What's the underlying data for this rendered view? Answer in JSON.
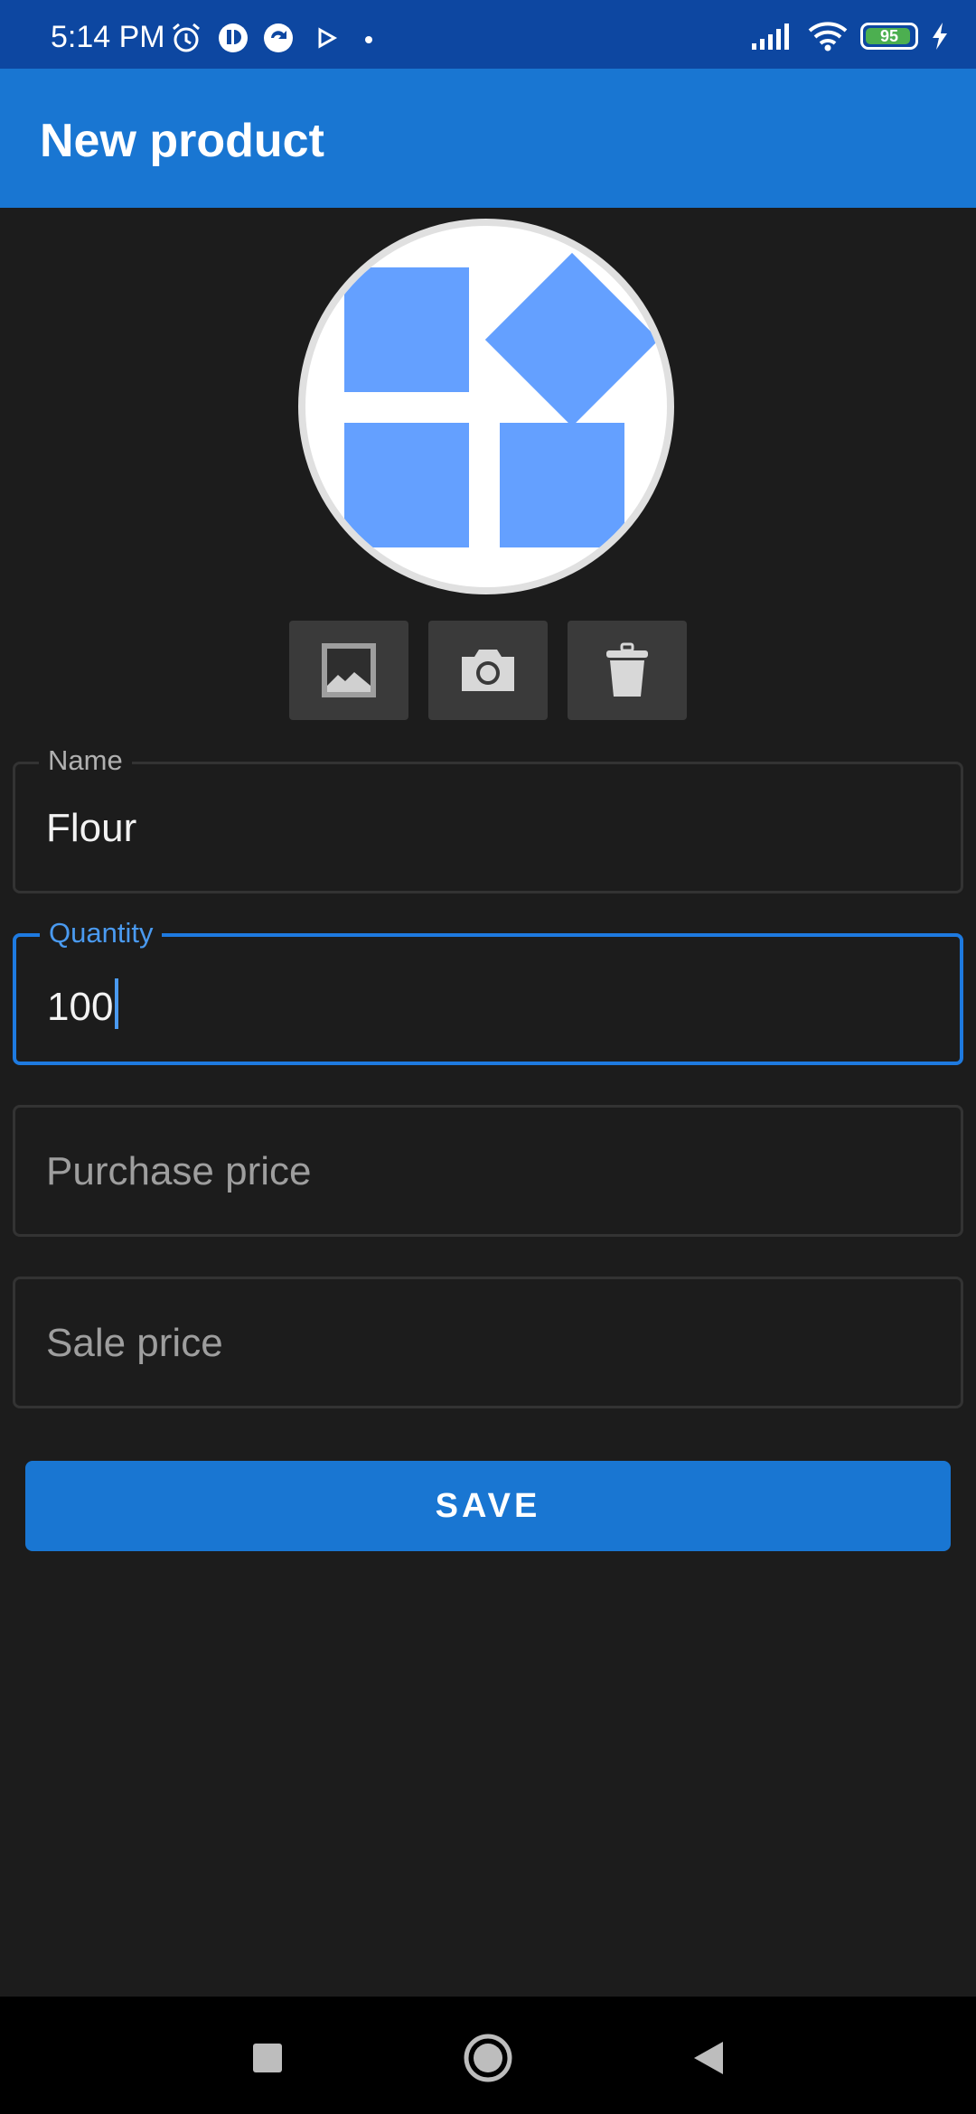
{
  "status_bar": {
    "time": "5:14 PM",
    "battery_level": 95,
    "battery_text": "95",
    "icons": [
      "alarm-icon",
      "app-notification-icon",
      "sync-icon",
      "play-icon",
      "dot-icon",
      "signal-icon",
      "wifi-icon",
      "battery-icon",
      "charging-icon"
    ]
  },
  "app_bar": {
    "title": "New product"
  },
  "image_actions": {
    "gallery_icon": "gallery-icon",
    "camera_icon": "camera-icon",
    "delete_icon": "trash-icon"
  },
  "form": {
    "name": {
      "label": "Name",
      "value": "Flour"
    },
    "quantity": {
      "label": "Quantity",
      "value": "100"
    },
    "purchase_price": {
      "placeholder": "Purchase price"
    },
    "sale_price": {
      "placeholder": "Sale price"
    }
  },
  "save_button": {
    "label": "SAVE"
  },
  "nav_bar": {
    "icons": [
      "recents-icon",
      "home-icon",
      "back-icon"
    ]
  },
  "colors": {
    "status_bar": "#0d47a1",
    "app_bar": "#1976d2",
    "accent": "#1e7ae0",
    "background": "#1c1c1c",
    "placeholder_tile": "#64a0ff"
  }
}
